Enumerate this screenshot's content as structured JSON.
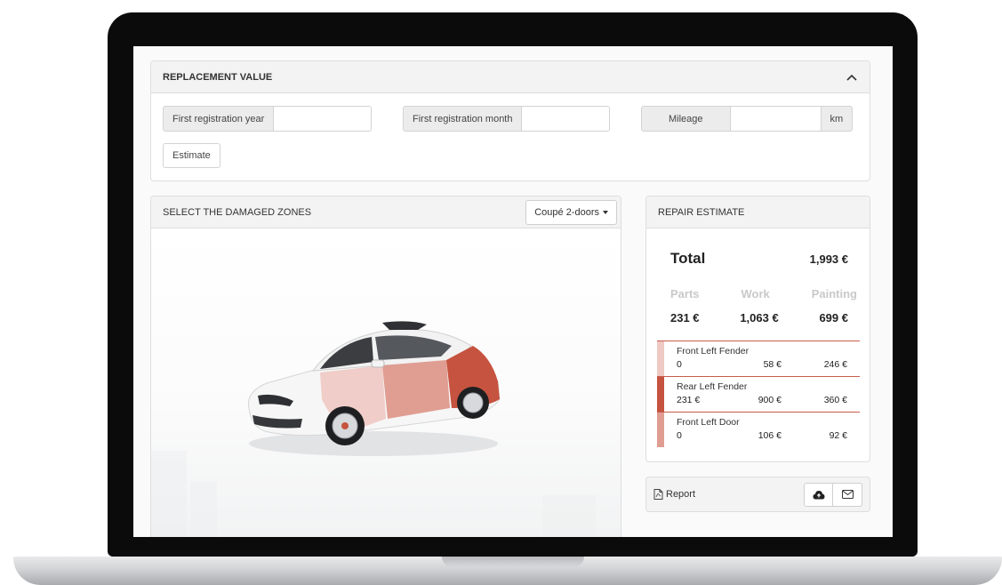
{
  "replacement_value": {
    "title": "REPLACEMENT VALUE",
    "collapse_icon": "chevron-up-icon",
    "fields": {
      "first_registration_year": {
        "label": "First registration year",
        "value": ""
      },
      "first_registration_month": {
        "label": "First registration month",
        "value": ""
      },
      "mileage": {
        "label": "Mileage",
        "value": "",
        "unit": "km"
      }
    },
    "estimate_button": "Estimate"
  },
  "damaged_zones": {
    "title": "SELECT THE DAMAGED ZONES",
    "body_type": "Coupé 2-doors",
    "zone_colors": {
      "front_left_fender": "#efc9c3",
      "rear_left_fender": "#c6533f",
      "front_left_door": "#e09d92"
    }
  },
  "repair_estimate": {
    "title": "REPAIR ESTIMATE",
    "total_label": "Total",
    "total_value": "1,993 €",
    "columns": {
      "parts": "Parts",
      "work": "Work",
      "painting": "Painting"
    },
    "sums": {
      "parts": "231 €",
      "work": "1,063 €",
      "painting": "699 €"
    },
    "items": [
      {
        "name": "Front Left Fender",
        "parts": "0",
        "work": "58 €",
        "painting": "246 €",
        "color": "#efc9c3"
      },
      {
        "name": "Rear Left Fender",
        "parts": "231 €",
        "work": "900 €",
        "painting": "360 €",
        "color": "#c6533f"
      },
      {
        "name": "Front Left Door",
        "parts": "0",
        "work": "106 €",
        "painting": "92 €",
        "color": "#e09d92"
      }
    ]
  },
  "report": {
    "label": "Report",
    "icons": {
      "report": "pdf-file-icon",
      "upload": "cloud-upload-icon",
      "email": "envelope-icon"
    }
  }
}
